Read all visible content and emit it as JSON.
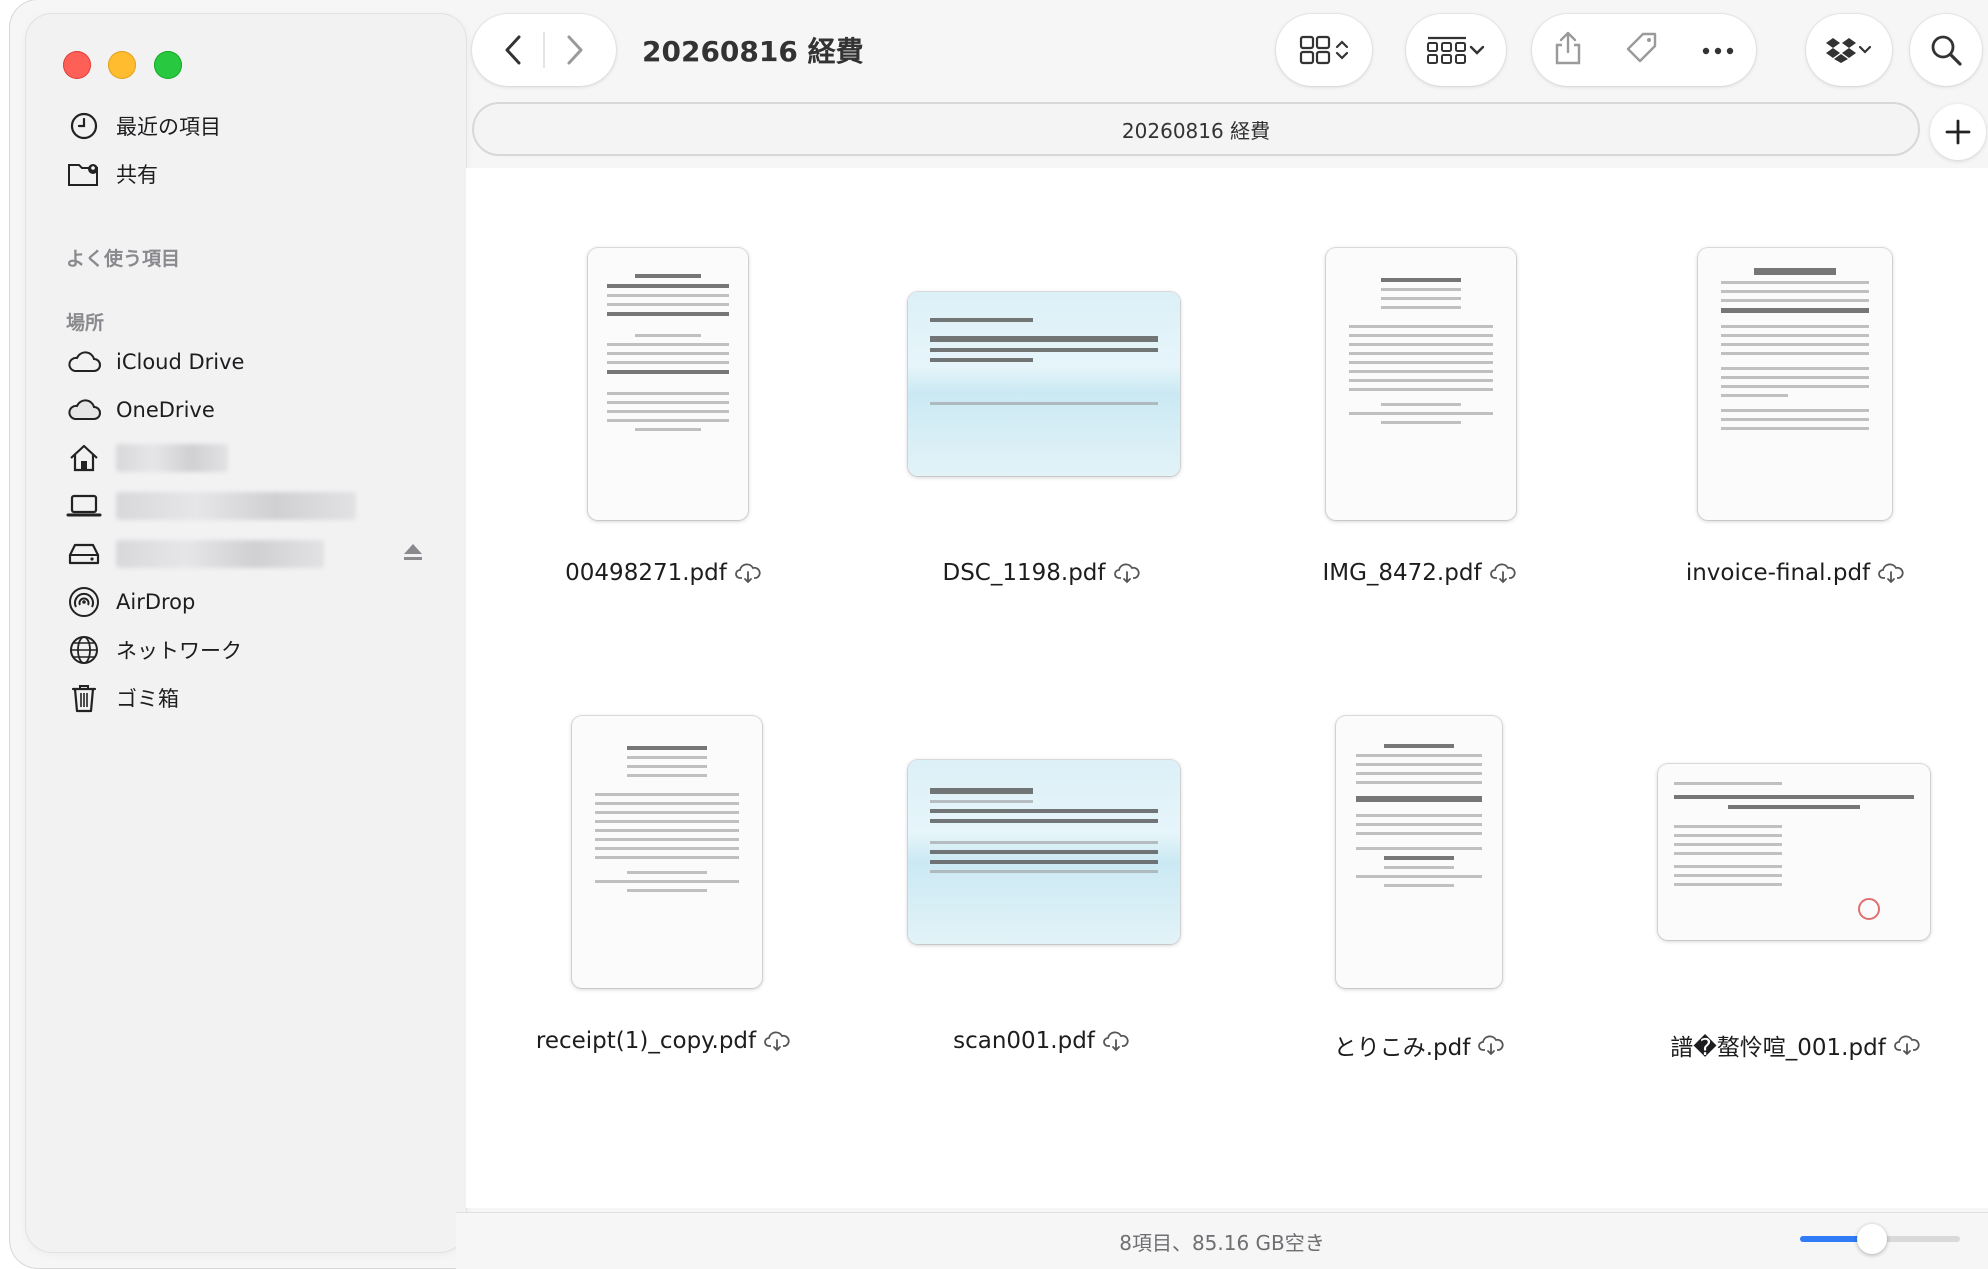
{
  "window": {
    "title": "20260816 経費",
    "path": "20260816 経費"
  },
  "sidebar": {
    "items_top": [
      {
        "label": "最近の項目",
        "icon": "clock-icon"
      },
      {
        "label": "共有",
        "icon": "shared-folder-icon"
      }
    ],
    "favorites_header": "よく使う項目",
    "locations_header": "場所",
    "locations": [
      {
        "label": "iCloud Drive",
        "icon": "cloud-icon"
      },
      {
        "label": "OneDrive",
        "icon": "cloud-icon"
      },
      {
        "label": "",
        "icon": "home-icon",
        "redacted": true
      },
      {
        "label": "",
        "icon": "laptop-icon",
        "redacted": true
      },
      {
        "label": "",
        "icon": "drive-icon",
        "redacted": true
      },
      {
        "label": "AirDrop",
        "icon": "airdrop-icon"
      },
      {
        "label": "ネットワーク",
        "icon": "network-globe-icon"
      },
      {
        "label": "ゴミ箱",
        "icon": "trash-icon"
      }
    ]
  },
  "files": [
    {
      "name": "00498271.pdf",
      "kind": "receipt"
    },
    {
      "name": "DSC_1198.pdf",
      "kind": "ticket"
    },
    {
      "name": "IMG_8472.pdf",
      "kind": "receipt"
    },
    {
      "name": "invoice-final.pdf",
      "kind": "receipt"
    },
    {
      "name": "receipt(1)_copy.pdf",
      "kind": "receipt"
    },
    {
      "name": "scan001.pdf",
      "kind": "ticket"
    },
    {
      "name": "とりこみ.pdf",
      "kind": "receipt"
    },
    {
      "name": "譜�螯怜喧_001.pdf",
      "kind": "wide-receipt"
    }
  ],
  "status": {
    "text": "8項目、85.16 GB空き",
    "icon_size_fraction": 0.45
  },
  "colors": {
    "accent": "#2f7cf6",
    "close": "#fe5f57",
    "minimize": "#febc2e",
    "zoom": "#28c840"
  }
}
